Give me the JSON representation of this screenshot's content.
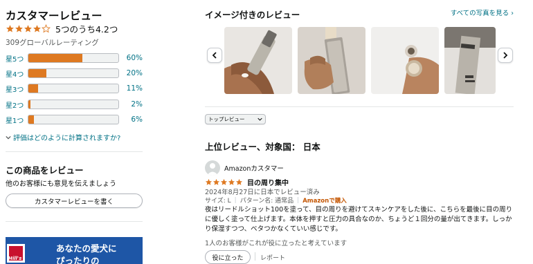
{
  "summary": {
    "title": "カスタマーレビュー",
    "rating_value": 4.2,
    "rating_text": "5つのうち4.2つ",
    "global_count": "309グローバルレーティング",
    "histogram": [
      {
        "label": "星5つ",
        "percent_text": "60%",
        "percent": 60
      },
      {
        "label": "星4つ",
        "percent_text": "20%",
        "percent": 20
      },
      {
        "label": "星3つ",
        "percent_text": "11%",
        "percent": 11
      },
      {
        "label": "星2つ",
        "percent_text": "2%",
        "percent": 2
      },
      {
        "label": "星1つ",
        "percent_text": "6%",
        "percent": 6
      }
    ],
    "calc_link": "評価はどのように計算されますか?"
  },
  "write_review": {
    "title": "この商品をレビュー",
    "subtitle": "他のお客様にも意見を伝えましょう",
    "button": "カスタマーレビューを書く"
  },
  "ad": {
    "line1": "あなたの愛犬に",
    "line2": "ぴったりの",
    "logo_text": "Hill's"
  },
  "images_section": {
    "title": "イメージ付きのレビュー",
    "see_all": "すべての写真を見る ›",
    "prev_icon": "chevron-left-icon",
    "next_icon": "chevron-right-icon"
  },
  "sort": {
    "selected": "トップレビュー"
  },
  "reviews_header": "上位レビュー、対象国： 日本",
  "review": {
    "author": "Amazonカスタマー",
    "rating": 5,
    "title": "目の周り集中",
    "date": "2024年8月27日に日本でレビュー済み",
    "size": "サイズ: L",
    "pattern": "パターン名: 通常品",
    "verified": "Amazonで購入",
    "body": "夜はリードルショット100を塗って、目の周りを避けてスキンケアをした後に、こちらを最後に目の周りに優しく塗って仕上げます。本体を押すと圧力の具合なのか、ちょうど１回分の量が出てきます。しっかり保湿すつつ、ベタつかなくていい感じです。",
    "helpful_text": "1人のお客様がこれが役に立ったと考えています",
    "helpful_button": "役に立った",
    "report": "レポート"
  },
  "colors": {
    "star": "#de7921",
    "link": "#007185",
    "verified": "#c45500",
    "ad_bg": "#1e56a6"
  }
}
